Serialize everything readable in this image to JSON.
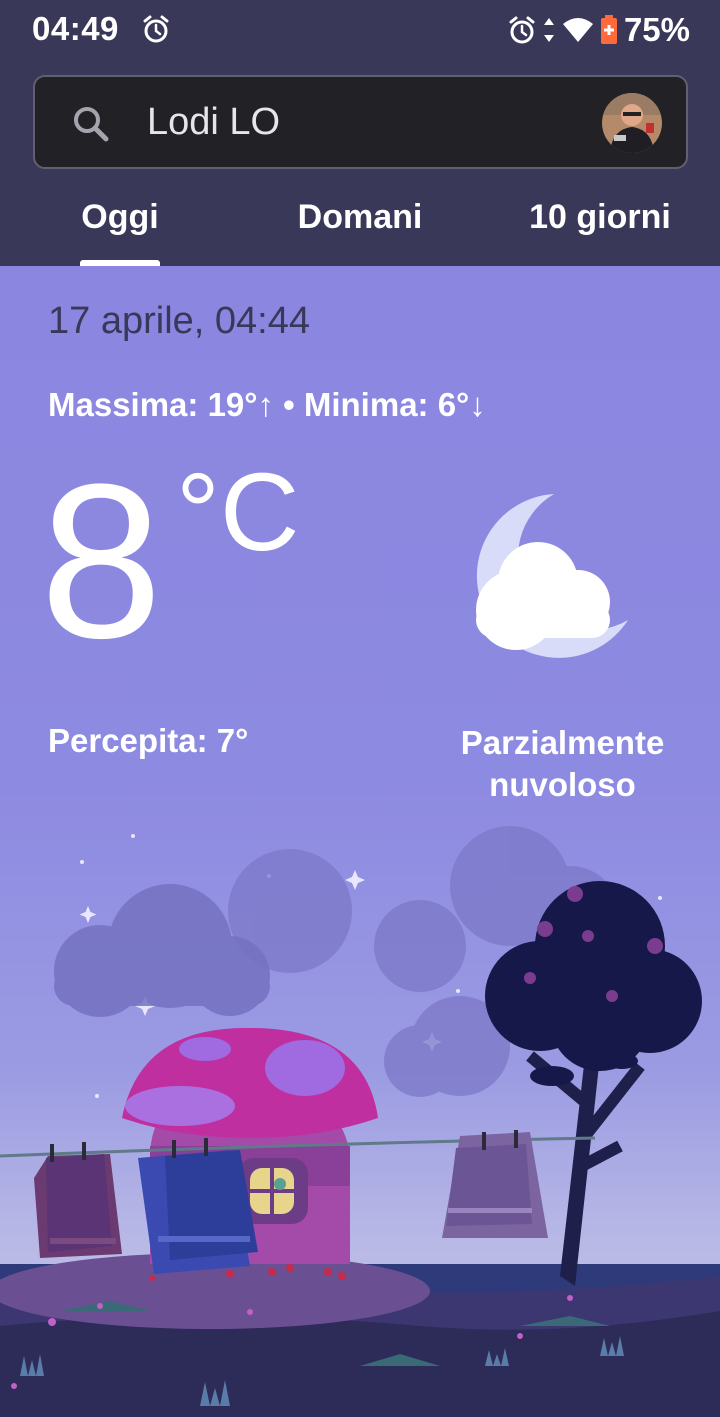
{
  "status_bar": {
    "time": "04:49",
    "battery": "75%",
    "icons": [
      "alarm-icon",
      "alarm-icon",
      "data-arrows-icon",
      "wifi-icon",
      "battery-saver-icon"
    ]
  },
  "search": {
    "location": "Lodi LO",
    "icon": "search-icon"
  },
  "tabs": [
    {
      "label": "Oggi",
      "selected": true
    },
    {
      "label": "Domani",
      "selected": false
    },
    {
      "label": "10 giorni",
      "selected": false
    }
  ],
  "weather": {
    "datetime": "17 aprile, 04:44",
    "range": "Massima: 19°↑ • Minima: 6°↓",
    "temperature": "8",
    "unit": "°C",
    "feels_like": "Percepita: 7°",
    "condition_line1": "Parzialmente",
    "condition_line2": "nuvoloso",
    "condition_icon": "partly-cloudy-night-icon"
  },
  "colors": {
    "header_bg": "#3a3858",
    "panel_top": "#8b86e0",
    "mushroom_cap": "#c02fa0"
  }
}
